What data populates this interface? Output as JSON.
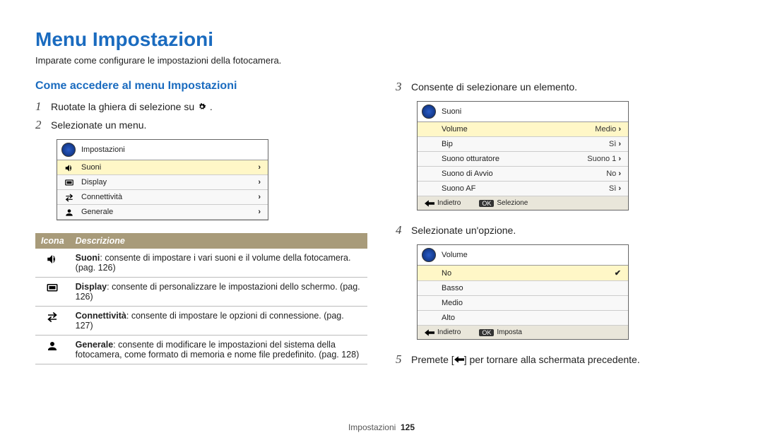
{
  "title": "Menu Impostazioni",
  "intro": "Imparate come configurare le impostazioni della fotocamera.",
  "left": {
    "heading": "Come accedere al menu Impostazioni",
    "step1_pre": "Ruotate la ghiera di selezione su ",
    "step1_post": ".",
    "step2": "Selezionate un menu.",
    "screen1": {
      "title": "Impostazioni",
      "rows": [
        {
          "label": "Suoni"
        },
        {
          "label": "Display"
        },
        {
          "label": "Connettività"
        },
        {
          "label": "Generale"
        }
      ]
    },
    "table": {
      "h_icon": "Icona",
      "h_desc": "Descrizione",
      "rows": [
        {
          "bold": "Suoni",
          "rest": ": consente di impostare i vari suoni e il volume della fotocamera. (pag. 126)"
        },
        {
          "bold": "Display",
          "rest": ": consente di personalizzare le impostazioni dello schermo. (pag. 126)"
        },
        {
          "bold": "Connettività",
          "rest": ": consente di impostare le opzioni di connessione. (pag. 127)"
        },
        {
          "bold": "Generale",
          "rest": ": consente di modificare le impostazioni del sistema della fotocamera, come formato di memoria e nome file predefinito. (pag. 128)"
        }
      ]
    }
  },
  "right": {
    "step3": "Consente di selezionare un elemento.",
    "step4": "Selezionate un'opzione.",
    "step5_pre": "Premete [",
    "step5_post": "] per tornare alla schermata precedente.",
    "screen2": {
      "title": "Suoni",
      "rows": [
        {
          "label": "Volume",
          "val": "Medio",
          "selected": true
        },
        {
          "label": "Bip",
          "val": "Sì"
        },
        {
          "label": "Suono otturatore",
          "val": "Suono 1"
        },
        {
          "label": "Suono di Avvio",
          "val": "No"
        },
        {
          "label": "Suono AF",
          "val": "Sì"
        }
      ],
      "footer_back": "Indietro",
      "footer_ok_key": "OK",
      "footer_ok": "Selezione"
    },
    "screen3": {
      "title": "Volume",
      "rows": [
        {
          "label": "No",
          "checked": true
        },
        {
          "label": "Basso"
        },
        {
          "label": "Medio"
        },
        {
          "label": "Alto"
        }
      ],
      "footer_back": "Indietro",
      "footer_ok_key": "OK",
      "footer_ok": "Imposta"
    }
  },
  "footer": {
    "chapter": "Impostazioni",
    "page": "125"
  }
}
